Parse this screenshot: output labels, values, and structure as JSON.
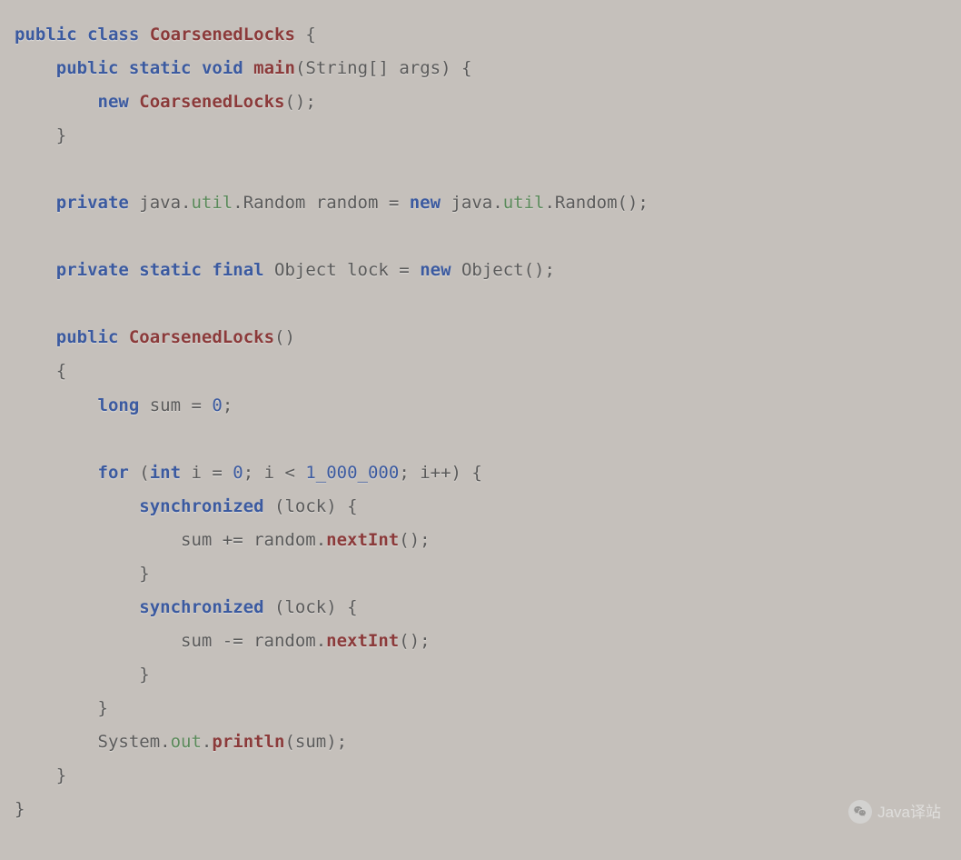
{
  "code": {
    "tokens": [
      [
        {
          "c": "kw",
          "t": "public"
        },
        {
          "c": "txt",
          "t": " "
        },
        {
          "c": "kw",
          "t": "class"
        },
        {
          "c": "txt",
          "t": " "
        },
        {
          "c": "cls",
          "t": "CoarsenedLocks"
        },
        {
          "c": "txt",
          "t": " {"
        }
      ],
      [
        {
          "c": "txt",
          "t": "    "
        },
        {
          "c": "kw",
          "t": "public"
        },
        {
          "c": "txt",
          "t": " "
        },
        {
          "c": "kw",
          "t": "static"
        },
        {
          "c": "txt",
          "t": " "
        },
        {
          "c": "kw",
          "t": "void"
        },
        {
          "c": "txt",
          "t": " "
        },
        {
          "c": "mtd",
          "t": "main"
        },
        {
          "c": "txt",
          "t": "(String[] args) {"
        }
      ],
      [
        {
          "c": "txt",
          "t": "        "
        },
        {
          "c": "kw",
          "t": "new"
        },
        {
          "c": "txt",
          "t": " "
        },
        {
          "c": "cls",
          "t": "CoarsenedLocks"
        },
        {
          "c": "txt",
          "t": "();"
        }
      ],
      [
        {
          "c": "txt",
          "t": "    }"
        }
      ],
      [
        {
          "c": "txt",
          "t": ""
        }
      ],
      [
        {
          "c": "txt",
          "t": "    "
        },
        {
          "c": "kw",
          "t": "private"
        },
        {
          "c": "txt",
          "t": " java."
        },
        {
          "c": "pkg",
          "t": "util"
        },
        {
          "c": "txt",
          "t": ".Random random = "
        },
        {
          "c": "kw",
          "t": "new"
        },
        {
          "c": "txt",
          "t": " java."
        },
        {
          "c": "pkg",
          "t": "util"
        },
        {
          "c": "txt",
          "t": ".Random();"
        }
      ],
      [
        {
          "c": "txt",
          "t": ""
        }
      ],
      [
        {
          "c": "txt",
          "t": "    "
        },
        {
          "c": "kw",
          "t": "private"
        },
        {
          "c": "txt",
          "t": " "
        },
        {
          "c": "kw",
          "t": "static"
        },
        {
          "c": "txt",
          "t": " "
        },
        {
          "c": "kw",
          "t": "final"
        },
        {
          "c": "txt",
          "t": " Object lock = "
        },
        {
          "c": "kw",
          "t": "new"
        },
        {
          "c": "txt",
          "t": " Object();"
        }
      ],
      [
        {
          "c": "txt",
          "t": ""
        }
      ],
      [
        {
          "c": "txt",
          "t": "    "
        },
        {
          "c": "kw",
          "t": "public"
        },
        {
          "c": "txt",
          "t": " "
        },
        {
          "c": "cls",
          "t": "CoarsenedLocks"
        },
        {
          "c": "txt",
          "t": "()"
        }
      ],
      [
        {
          "c": "txt",
          "t": "    {"
        }
      ],
      [
        {
          "c": "txt",
          "t": "        "
        },
        {
          "c": "kw",
          "t": "long"
        },
        {
          "c": "txt",
          "t": " sum = "
        },
        {
          "c": "num",
          "t": "0"
        },
        {
          "c": "txt",
          "t": ";"
        }
      ],
      [
        {
          "c": "txt",
          "t": ""
        }
      ],
      [
        {
          "c": "txt",
          "t": "        "
        },
        {
          "c": "kw",
          "t": "for"
        },
        {
          "c": "txt",
          "t": " ("
        },
        {
          "c": "kw",
          "t": "int"
        },
        {
          "c": "txt",
          "t": " i = "
        },
        {
          "c": "num",
          "t": "0"
        },
        {
          "c": "txt",
          "t": "; i < "
        },
        {
          "c": "num",
          "t": "1_000_000"
        },
        {
          "c": "txt",
          "t": "; i++) {"
        }
      ],
      [
        {
          "c": "txt",
          "t": "            "
        },
        {
          "c": "kw",
          "t": "synchronized"
        },
        {
          "c": "txt",
          "t": " (lock) {"
        }
      ],
      [
        {
          "c": "txt",
          "t": "                sum += random."
        },
        {
          "c": "mtd",
          "t": "nextInt"
        },
        {
          "c": "txt",
          "t": "();"
        }
      ],
      [
        {
          "c": "txt",
          "t": "            }"
        }
      ],
      [
        {
          "c": "txt",
          "t": "            "
        },
        {
          "c": "kw",
          "t": "synchronized"
        },
        {
          "c": "txt",
          "t": " (lock) {"
        }
      ],
      [
        {
          "c": "txt",
          "t": "                sum -= random."
        },
        {
          "c": "mtd",
          "t": "nextInt"
        },
        {
          "c": "txt",
          "t": "();"
        }
      ],
      [
        {
          "c": "txt",
          "t": "            }"
        }
      ],
      [
        {
          "c": "txt",
          "t": "        }"
        }
      ],
      [
        {
          "c": "txt",
          "t": "        System."
        },
        {
          "c": "fld",
          "t": "out"
        },
        {
          "c": "txt",
          "t": "."
        },
        {
          "c": "mtd",
          "t": "println"
        },
        {
          "c": "txt",
          "t": "(sum);"
        }
      ],
      [
        {
          "c": "txt",
          "t": "    }"
        }
      ],
      [
        {
          "c": "txt",
          "t": "}"
        }
      ]
    ]
  },
  "watermark": {
    "label": "Java译站"
  }
}
